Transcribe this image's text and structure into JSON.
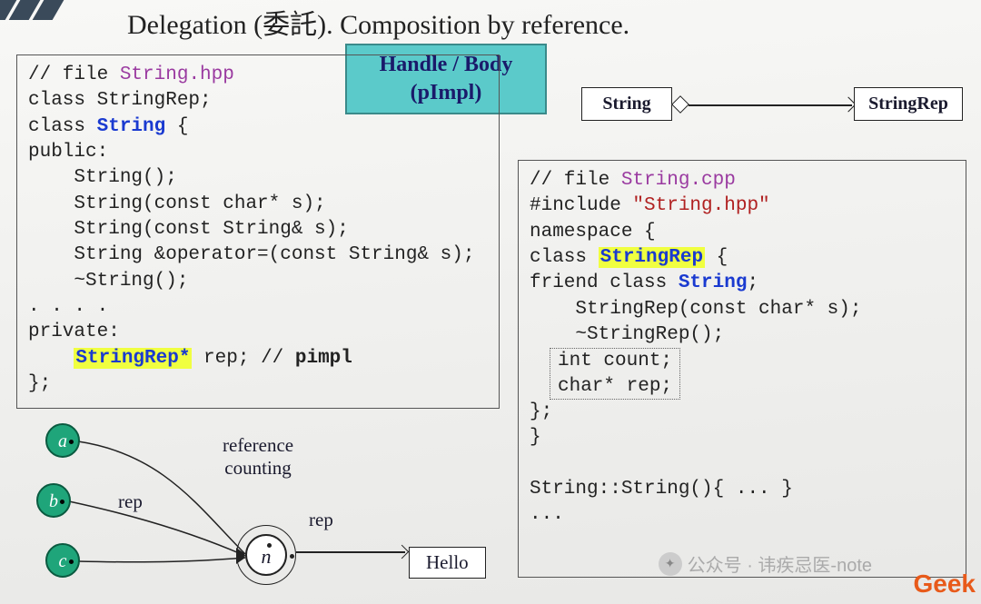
{
  "heading": "Delegation (委託). Composition by reference.",
  "handle_body": {
    "line1": "Handle / Body",
    "line2": "(pImpl)"
  },
  "uml": {
    "left": "String",
    "right": "StringRep"
  },
  "code_left": {
    "c1": "// file ",
    "c1_file": "String.hpp",
    "c2": "class StringRep;",
    "c3a": "class ",
    "c3b": "String",
    "c3c": " {",
    "c4": "public:",
    "c5": "    String();",
    "c6": "    String(const char* s);",
    "c7": "    String(const String& s);",
    "c8": "    String &operator=(const String& s);",
    "c9": "    ~String();",
    "c10": ". . . .",
    "c11": "private:",
    "c12a": "    ",
    "c12b": "StringRep*",
    "c12c": " rep; // ",
    "c12d": "pimpl",
    "c13": "};"
  },
  "code_right": {
    "r1": "// file ",
    "r1_file": "String.cpp",
    "r2a": "#include ",
    "r2b": "\"String.hpp\"",
    "r3": "namespace {",
    "r4a": "class ",
    "r4b": "StringRep",
    "r4c": " {",
    "r5a": "friend class ",
    "r5b": "String",
    "r5c": ";",
    "r6": "    StringRep(const char* s);",
    "r7": "    ~StringRep();",
    "r8a": "int count;",
    "r8b": "char* rep;",
    "r9": "};",
    "r10": "}",
    "r11": "String::String(){ ... }",
    "r12": "..."
  },
  "diagram": {
    "a": "a",
    "b": "b",
    "c": "c",
    "n": "n",
    "rep": "rep",
    "ref_counting_l1": "reference",
    "ref_counting_l2": "counting",
    "hello": "Hello"
  },
  "brand": "Geek",
  "watermark": "公众号 · 讳疾忌医-note"
}
